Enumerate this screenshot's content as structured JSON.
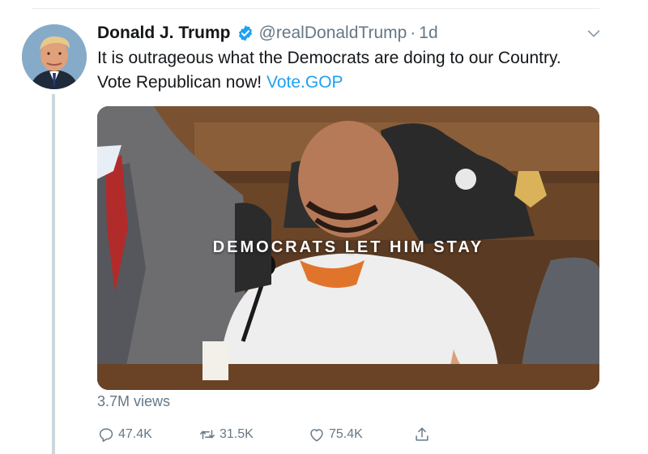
{
  "tweet": {
    "display_name": "Donald J. Trump",
    "handle": "@realDonaldTrump",
    "separator": "·",
    "time": "1d",
    "text_before_link": "It is outrageous what the Democrats are doing to our Country. Vote Republican now! ",
    "link_text": "Vote.GOP",
    "media_caption": "DEMOCRATS LET HIM STAY",
    "views": "3.7M views"
  },
  "actions": {
    "reply_count": "47.4K",
    "retweet_count": "31.5K",
    "like_count": "75.4K"
  },
  "icons": {
    "verified": "verified-badge-icon",
    "more": "chevron-down-icon",
    "reply": "reply-icon",
    "retweet": "retweet-icon",
    "like": "heart-icon",
    "share": "share-icon"
  },
  "colors": {
    "link": "#1da1f2",
    "secondary_text": "#657786",
    "primary_text": "#14171a"
  }
}
